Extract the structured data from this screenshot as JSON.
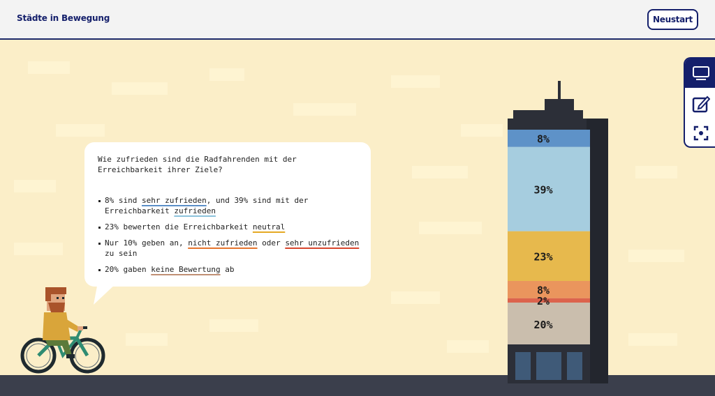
{
  "header": {
    "title": "Städte in Bewegung",
    "restart_label": "Neustart"
  },
  "sidebar": {
    "buttons": [
      {
        "icon": "screen-icon",
        "active": true
      },
      {
        "icon": "edit-icon",
        "active": false
      },
      {
        "icon": "focus-frame-icon",
        "active": false
      }
    ]
  },
  "bubble": {
    "question": "Wie zufrieden sind die Radfahrenden mit der Erreichbarkeit ihrer Ziele?",
    "b1_a": "8% sind ",
    "b1_u1": "sehr zufrieden",
    "b1_b": ", und 39% sind mit der Erreichbarkeit ",
    "b1_u2": "zufrieden",
    "b2_a": "23% bewerten die Erreichbarkeit ",
    "b2_u1": "neutral",
    "b3_a": "Nur 10% geben an, ",
    "b3_u1": "nicht zufrieden",
    "b3_b": " oder ",
    "b3_u2": "sehr unzufrieden",
    "b3_c": " zu sein",
    "b4_a": "20% gaben ",
    "b4_u1": "keine Bewertung",
    "b4_b": " ab"
  },
  "chart_data": {
    "type": "bar",
    "categories": [
      "sehr zufrieden",
      "zufrieden",
      "neutral",
      "nicht zufrieden",
      "sehr unzufrieden",
      "keine Bewertung"
    ],
    "values": [
      8,
      39,
      23,
      8,
      2,
      20
    ],
    "labels": [
      "8%",
      "39%",
      "23%",
      "8%",
      "2%",
      "20%"
    ],
    "colors": [
      "#4a86c6",
      "#9cc9e0",
      "#e6b33a",
      "#e98a4c",
      "#d9513a",
      "#c5b8a7"
    ]
  }
}
